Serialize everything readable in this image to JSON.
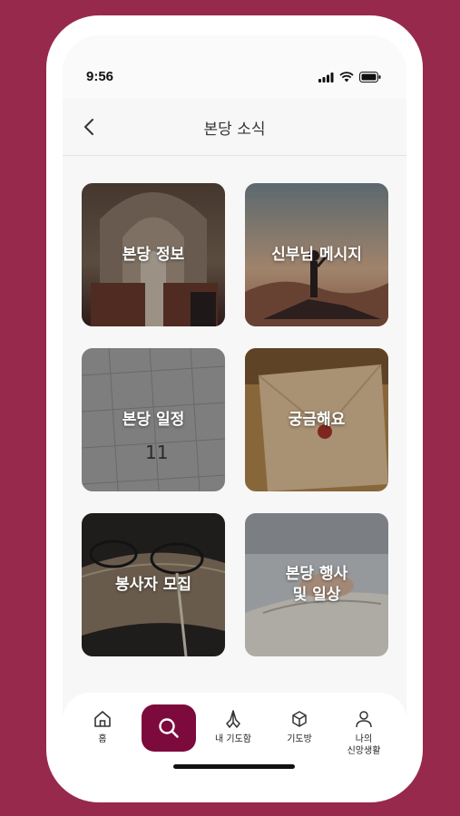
{
  "status": {
    "time": "9:56"
  },
  "header": {
    "title": "본당 소식"
  },
  "cards": [
    {
      "label": "본당 정보"
    },
    {
      "label": "신부님 메시지"
    },
    {
      "label": "본당 일정"
    },
    {
      "label": "궁금해요"
    },
    {
      "label": "봉사자 모집"
    },
    {
      "label": "본당 행사\n및 일상"
    }
  ],
  "tabbar": {
    "items": [
      {
        "label": "홈",
        "icon": "home-icon"
      },
      {
        "label": "",
        "icon": "search-icon"
      },
      {
        "label": "내 기도함",
        "icon": "praying-hands-icon"
      },
      {
        "label": "기도방",
        "icon": "cube-icon"
      },
      {
        "label": "나의\n신앙생활",
        "icon": "user-icon"
      }
    ]
  },
  "colors": {
    "brand": "#97294c",
    "accent": "#7d0a3d"
  }
}
